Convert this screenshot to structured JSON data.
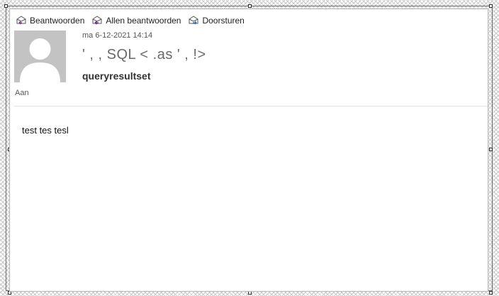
{
  "toolbar": {
    "reply_label": "Beantwoorden",
    "reply_all_label": "Allen beantwoorden",
    "forward_label": "Doorsturen"
  },
  "message": {
    "date": "ma 6-12-2021 14:14",
    "sender": "' ,  ,  SQL <    .as  '      ,         !>",
    "subject": "queryresultset",
    "to_label": "Aan",
    "body": "test tes tesl"
  },
  "colors": {
    "reply_accent": "#7a2e8e",
    "forward_accent": "#2a6fb6"
  }
}
